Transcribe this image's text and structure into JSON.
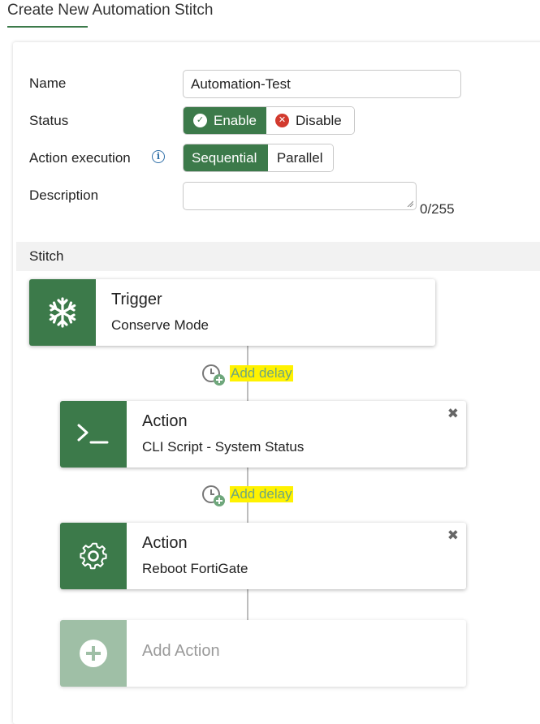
{
  "page": {
    "title": "Create New Automation Stitch"
  },
  "form": {
    "name_label": "Name",
    "name_value": "Automation-Test",
    "status_label": "Status",
    "status_options": {
      "enable": "Enable",
      "disable": "Disable",
      "selected": "Enable"
    },
    "action_execution_label": "Action execution",
    "action_execution_options": {
      "sequential": "Sequential",
      "parallel": "Parallel",
      "selected": "Sequential"
    },
    "description_label": "Description",
    "description_value": "",
    "description_count": "0/255"
  },
  "stitch": {
    "section_label": "Stitch",
    "trigger": {
      "title": "Trigger",
      "subtitle": "Conserve Mode",
      "icon": "snowflake-icon"
    },
    "delay_label": "Add delay",
    "actions": [
      {
        "title": "Action",
        "subtitle": "CLI Script - System Status",
        "icon": "terminal-icon"
      },
      {
        "title": "Action",
        "subtitle": "Reboot FortiGate",
        "icon": "gear-icon"
      }
    ],
    "add_action_label": "Add Action"
  },
  "colors": {
    "accent": "#3c7a4a",
    "accent_light": "#9fbfa6",
    "disable_icon": "#d23a2e",
    "highlight": "#fff200"
  }
}
